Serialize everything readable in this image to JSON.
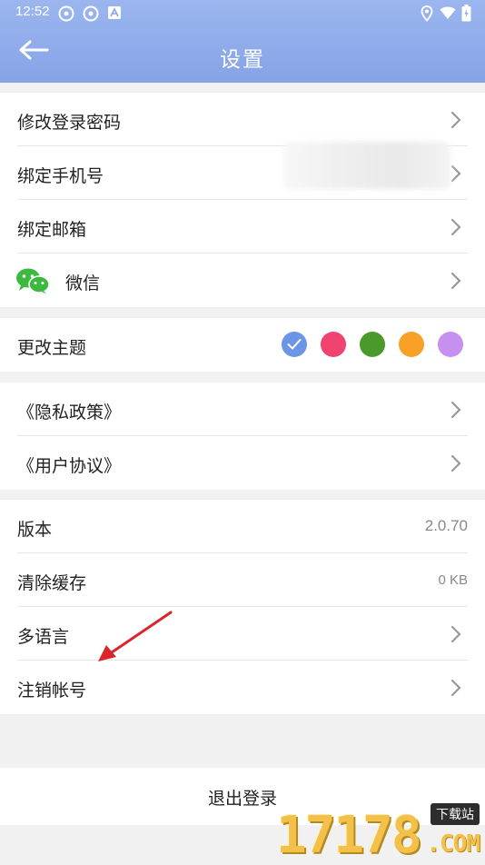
{
  "status_bar": {
    "time": "12:52",
    "icons": [
      "app-icon",
      "app-icon",
      "a-icon",
      "location-icon",
      "wifi-icon",
      "battery-icon"
    ]
  },
  "header": {
    "title": "设置",
    "back_icon": "arrow-left-icon"
  },
  "account_group": {
    "items": [
      {
        "label": "修改登录密码"
      },
      {
        "label": "绑定手机号"
      },
      {
        "label": "绑定邮箱"
      },
      {
        "label": "微信",
        "icon": "wechat-icon"
      }
    ]
  },
  "theme": {
    "label": "更改主题",
    "colors": [
      "#6b95e6",
      "#f0436f",
      "#4a9a2b",
      "#f9a126",
      "#c590f0"
    ],
    "selected_index": 0
  },
  "policy_group": {
    "items": [
      {
        "label": "《隐私政策》"
      },
      {
        "label": "《用户协议》"
      }
    ]
  },
  "misc_group": {
    "version_label": "版本",
    "version_value": "2.0.70",
    "cache_label": "清除缓存",
    "cache_value": "0 KB",
    "language_label": "多语言",
    "cancel_account_label": "注销帐号"
  },
  "logout": {
    "label": "退出登录"
  },
  "watermark": {
    "digits": "17178",
    "tag": "下载站",
    "suffix": ".COM"
  },
  "colors": {
    "header_top": "#9bb6ef",
    "header_bottom": "#86a3e6",
    "annotation_arrow": "#d9262a"
  }
}
